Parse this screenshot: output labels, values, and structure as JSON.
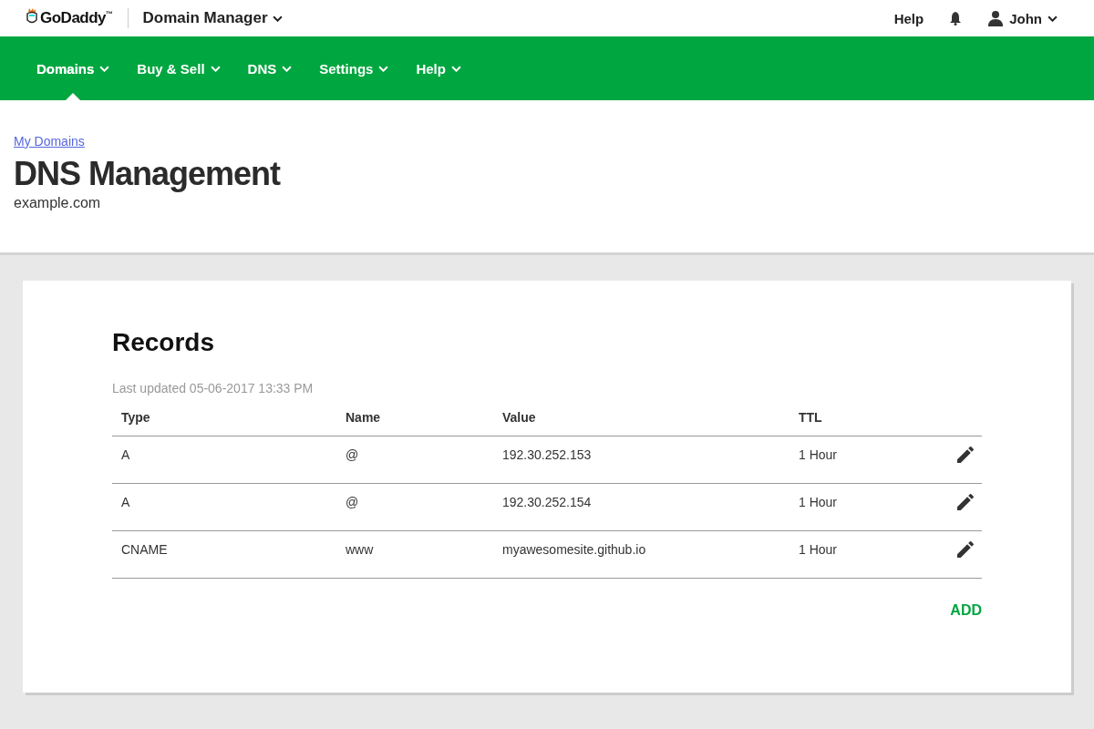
{
  "header": {
    "logo": "GoDaddy$^{™}$",
    "app_menu": "Domain Manager",
    "help": "Help",
    "user": "John"
  },
  "nav": [
    {
      "label": "Domains",
      "selected": true
    },
    {
      "label": "Buy & Sell",
      "selected": false
    },
    {
      "label": "DNS",
      "selected": false
    },
    {
      "label": "Settings",
      "selected": false
    },
    {
      "label": "Help",
      "selected": false
    }
  ],
  "breadcrumb": "My Domains",
  "title": "DNS Management",
  "domain": "example.com",
  "records": {
    "title": "Records",
    "last_updated": "Last updated 05-06-2017 13:33 PM",
    "columns": [
      "Type",
      "Name",
      "Value",
      "TTL"
    ],
    "rows": [
      [
        "A",
        "@",
        "192.30.252.153",
        "1 Hour"
      ],
      [
        "A",
        "@",
        "192.30.252.154",
        "1 Hour"
      ],
      [
        "CNAME",
        "www",
        "myawesomesite.github.io",
        "1 Hour"
      ]
    ],
    "add": "ADD"
  }
}
